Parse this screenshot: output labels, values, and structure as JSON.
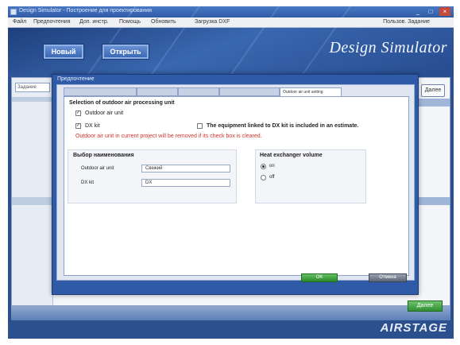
{
  "window": {
    "title": "Design Simulator - Построение для проектирования",
    "controls": [
      "_",
      "□",
      "×"
    ]
  },
  "menu": {
    "items": [
      "Файл",
      "Предпочтения",
      "Доп. инстр.",
      "Помощь",
      "Обновить",
      "Загрузка DXF"
    ],
    "user": "Пользов. Задание"
  },
  "banner": {
    "new_label": "Новый",
    "open_label": "Открыть",
    "logo": "Design Simulator"
  },
  "sidebar": {
    "tab_label": "Задание",
    "row_label": "Выбор"
  },
  "right_button": "Далее",
  "dialog": {
    "title": "Предпочтение",
    "tabs": [
      "",
      "",
      "",
      "",
      "Outdoor air unit setting"
    ],
    "section_title": "Selection of outdoor air processing unit",
    "outdoor_air_unit_label": "Outdoor air unit",
    "dx_kit_label": "DX kit",
    "equipment_note": "The equipment linked to DX kit is included in an estimate.",
    "warning": "Outdoor air unit in current project will be removed if its check box is cleared.",
    "naming": {
      "title": "Выбор наименования",
      "outdoor_air_unit_label": "Outdoor air unit",
      "outdoor_air_unit_value": "Свежий",
      "dx_kit_label": "DX kit",
      "dx_kit_value": "DX"
    },
    "heat_exchanger": {
      "title": "Heat exchanger volume",
      "options": [
        "on",
        "off"
      ],
      "selected": "on"
    },
    "ok_label": "OK",
    "cancel_label": "Отмена"
  },
  "footer": {
    "next_label": "Далее",
    "brand": "AIRSTAGE"
  },
  "colors": {
    "window_blue": "#2c4f8d",
    "dialog_blue": "#2e5aa8",
    "ok_green": "#2a8a2a",
    "warning_red": "#d2342a"
  }
}
